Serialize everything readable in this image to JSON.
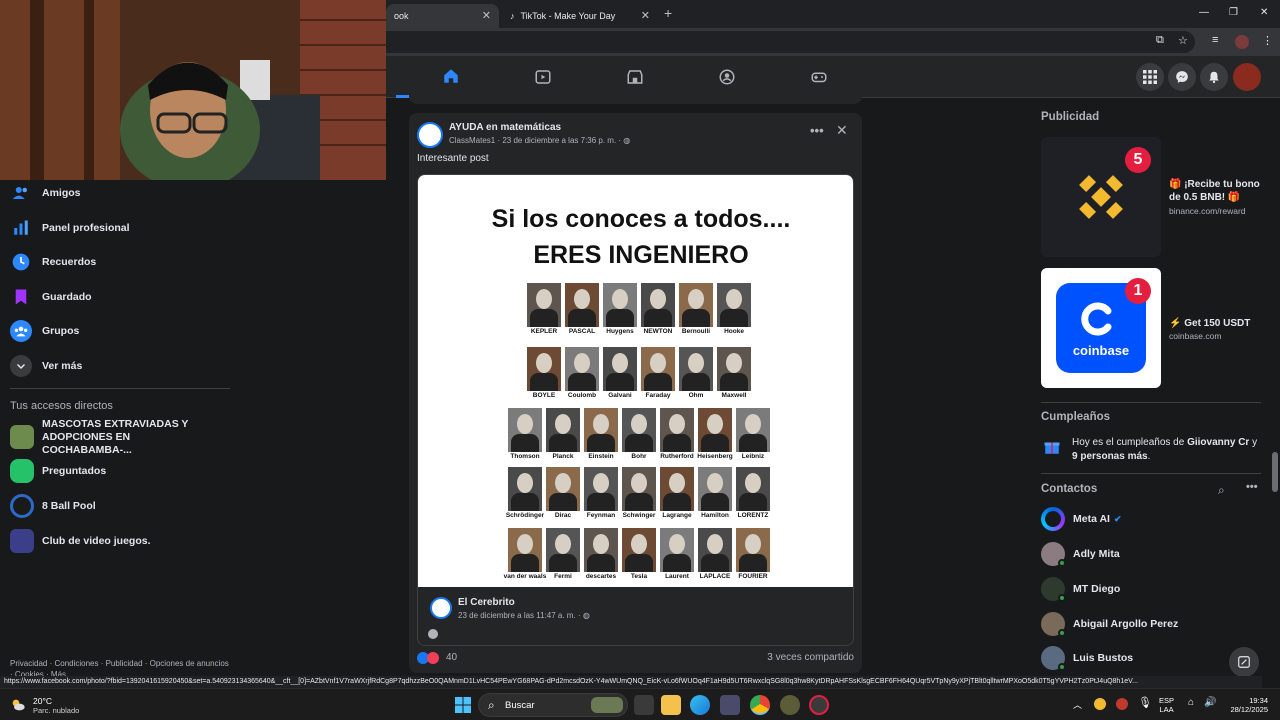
{
  "browser": {
    "tabs": [
      {
        "label": "ook",
        "active": true
      },
      {
        "label": "TikTok - Make Your Day",
        "active": false
      }
    ],
    "status_url": "https://www.facebook.com/photo/?fbid=1392041615920450&set=a.540923134365640&__cft__[0]=AZbtVnf1V7raWXrjfRdCg8P7qdhzzBeO0QAMnmD1LvHC54PEwYG68PAG-dPd2mcsdOzK-Y4wWUmQNQ_EicK-vLo6fWUOq4F1aH9d5UT6RwxclqSG8l0q3hw8KytDRpAHFSsKlsgECBF6FH64QUqr5VTpNy9yXPjTBlt0qlltwrMPXoO5dk0T5gYVPH2Tz0PtJ4uQ8h1eV..."
  },
  "sidebar": {
    "items": [
      {
        "label": "Amigos",
        "icon": "friends-icon"
      },
      {
        "label": "Panel profesional",
        "icon": "dashboard-icon"
      },
      {
        "label": "Recuerdos",
        "icon": "clock-icon"
      },
      {
        "label": "Guardado",
        "icon": "bookmark-icon"
      },
      {
        "label": "Grupos",
        "icon": "groups-icon"
      },
      {
        "label": "Ver más",
        "icon": "chevron-down-icon"
      }
    ],
    "shortcuts_title": "Tus accesos directos",
    "shortcuts": [
      {
        "label": "MASCOTAS EXTRAVIADAS Y ADOPCIONES EN COCHABAMBA-..."
      },
      {
        "label": "Preguntados"
      },
      {
        "label": "8 Ball Pool"
      },
      {
        "label": "Club de video juegos."
      }
    ],
    "footer": "Privacidad · Condiciones · Publicidad · Opciones de anuncios · Cookies · Más"
  },
  "post": {
    "group": "AYUDA en matemáticas",
    "sub": "ClassMates1 · 23 de diciembre a las 7:36 p. m. · ",
    "text": "Interesante post",
    "poster_title1": "Si los conoces a todos....",
    "poster_title2": "ERES INGENIERO",
    "scientists": [
      [
        "KEPLER",
        "PASCAL",
        "Huygens",
        "NEWTON",
        "Bernoulli",
        "Hooke"
      ],
      [
        "BOYLE",
        "Coulomb",
        "Galvani",
        "Faraday",
        "Ohm",
        "Maxwell"
      ],
      [
        "Thomson",
        "Planck",
        "Einstein",
        "Bohr",
        "Rutherford",
        "Heisenberg",
        "Leibniz"
      ],
      [
        "Schrödinger",
        "Dirac",
        "Feynman",
        "Schwinger",
        "Lagrange",
        "Hamilton",
        "LORENTZ"
      ],
      [
        "van der waals",
        "Fermi",
        "descartes",
        "Tesla",
        "Laurent",
        "LAPLACE",
        "FOURIER"
      ]
    ],
    "shared_name": "El Cerebrito",
    "shared_date": "23 de diciembre a las 11:47 a. m. · ",
    "reaction_count": "40",
    "shares": "3 veces compartido"
  },
  "right": {
    "ads_title": "Publicidad",
    "ads": [
      {
        "title": "🎁 ¡Recibe tu bono de 0.5 BNB! 🎁",
        "url": "binance.com/reward",
        "badge": "5"
      },
      {
        "title": "⚡ Get 150 USDT",
        "url": "coinbase.com",
        "badge": "1",
        "logo_text": "coinbase"
      }
    ],
    "birthdays_title": "Cumpleaños",
    "birthday_pre": "Hoy es el cumpleaños de ",
    "birthday_name": "Giiovanny Cr",
    "birthday_mid": " y ",
    "birthday_others": "9 personas más",
    "birthday_end": ".",
    "contacts_title": "Contactos",
    "contacts": [
      {
        "name": "Meta AI"
      },
      {
        "name": "Adly Mita"
      },
      {
        "name": "MT Diego"
      },
      {
        "name": "Abigail Argollo Perez"
      },
      {
        "name": "Luis Bustos"
      }
    ]
  },
  "taskbar": {
    "temp": "20°C",
    "weather": "Parc. nublado",
    "search": "Buscar",
    "lang1": "ESP",
    "lang2": "LAA",
    "time": "19:34",
    "date": "28/12/2025"
  },
  "colors": {
    "fb_blue": "#2d88ff",
    "badge_red": "#e41e3f",
    "binance_yellow": "#f3ba2f",
    "coinbase_blue": "#0052ff"
  }
}
